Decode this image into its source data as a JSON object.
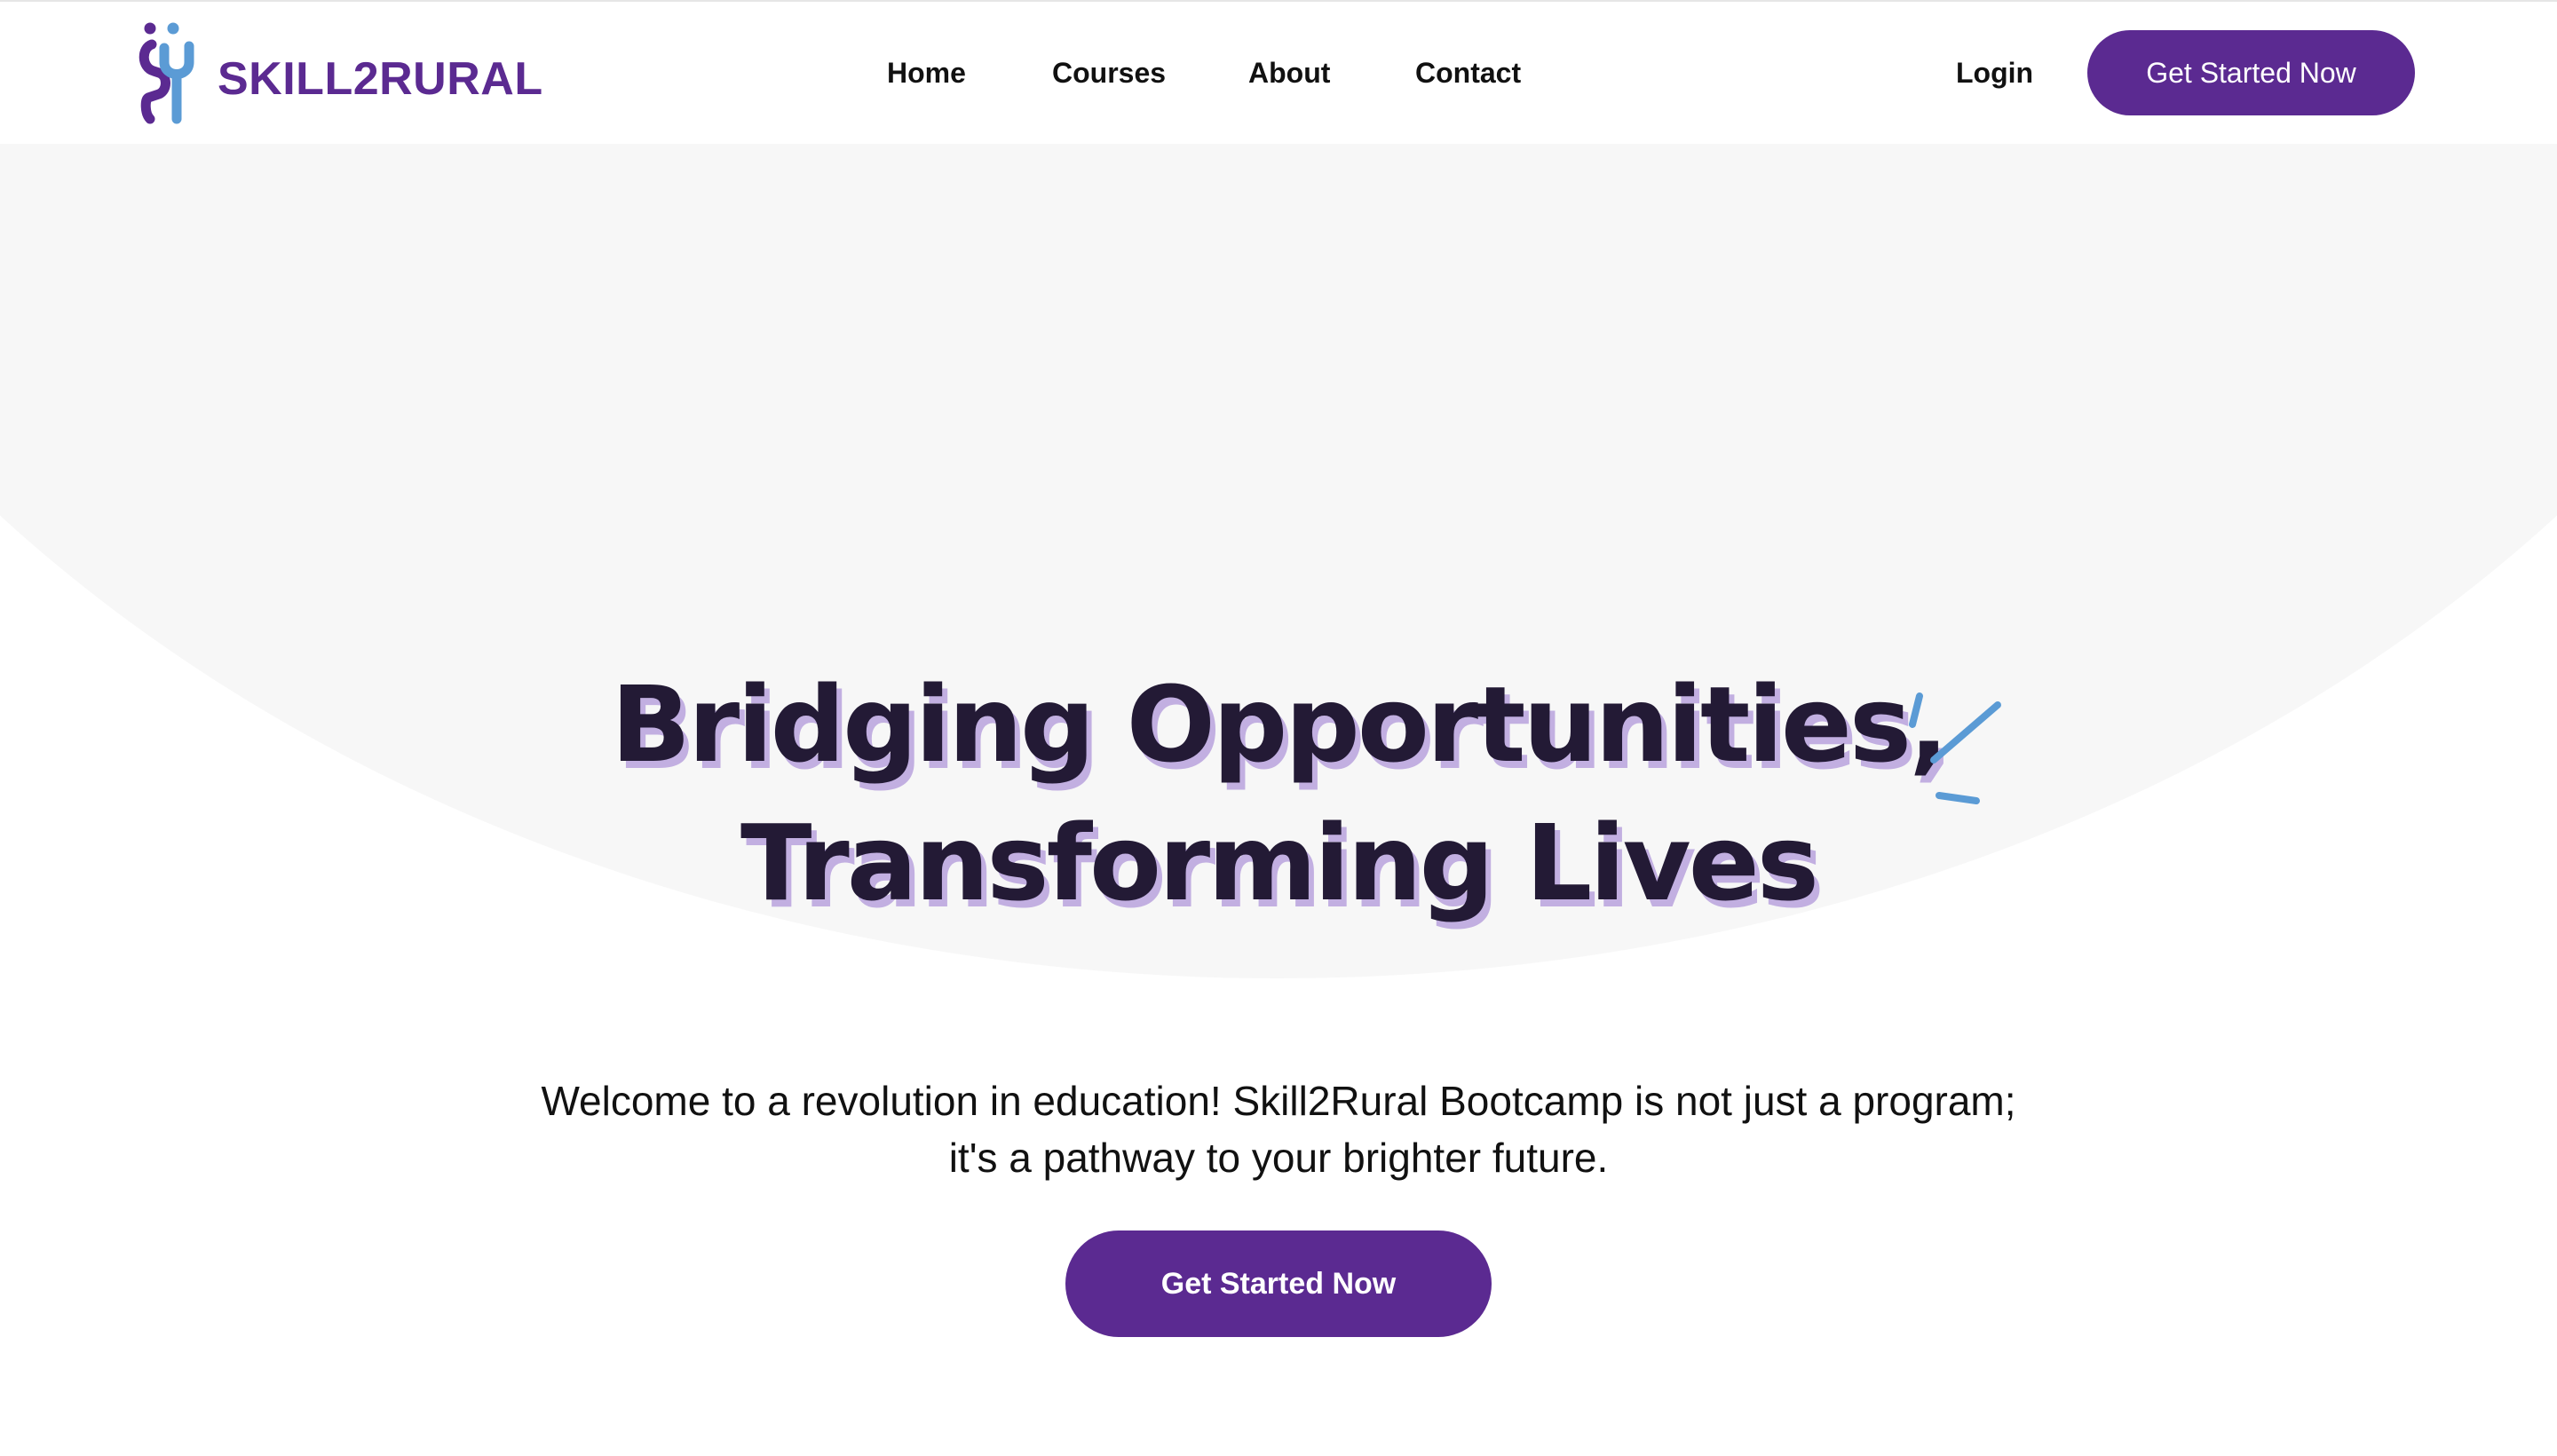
{
  "brand": {
    "name": "SKILL2RURAL",
    "color_primary": "#5b2a91",
    "color_secondary": "#5b9bd5"
  },
  "nav": {
    "links": [
      {
        "label": "Home"
      },
      {
        "label": "Courses"
      },
      {
        "label": "About"
      },
      {
        "label": "Contact"
      }
    ],
    "login_label": "Login",
    "cta_label": "Get Started Now"
  },
  "hero": {
    "headline_line1": "Bridging Opportunities,",
    "headline_line2": "Transforming Lives",
    "subtext_line1": "Welcome to a revolution in education! Skill2Rural Bootcamp is not just a program;",
    "subtext_line2": "it's a pathway to your brighter future.",
    "cta_label": "Get Started Now",
    "headline_color": "#231a35",
    "headline_shadow_color": "#c2afe1",
    "background_arc_color": "#f7f7f7",
    "decoration_icon": "sparkle-icon"
  }
}
